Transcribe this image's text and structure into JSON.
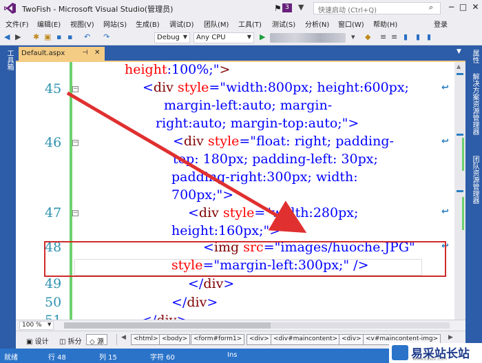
{
  "window": {
    "title": "TwoFish - Microsoft Visual Studio(管理员)",
    "notification_count": "3",
    "quick_launch_placeholder": "快速启动 (Ctrl+Q)",
    "controls": [
      "−",
      "□",
      "✕"
    ]
  },
  "menu": {
    "items": [
      "文件(F)",
      "编辑(E)",
      "视图(V)",
      "网站(S)",
      "生成(B)",
      "调试(D)",
      "团队(M)",
      "工具(T)",
      "测试(S)",
      "分析(N)",
      "窗口(W)",
      "帮助(H)"
    ],
    "login": "登录"
  },
  "toolbar": {
    "configuration": "Debug",
    "platform": "Any CPU"
  },
  "left_strip": {
    "label": "工具箱"
  },
  "right_strip": {
    "labels": [
      "属性",
      "解决方案资源管理器",
      "团队资源管理器"
    ]
  },
  "tabs": {
    "active": {
      "label": "Default.aspx",
      "pin": "⊣",
      "close": "✕"
    }
  },
  "editor": {
    "line_numbers": [
      "45",
      "46",
      "47",
      "48",
      "49",
      "50",
      "51"
    ],
    "code_lines": [
      {
        "parts": [
          [
            "c-attr",
            "height"
          ],
          [
            "c-punct",
            ":"
          ],
          [
            "c-val",
            "100%;\""
          ],
          [
            "c-tag",
            ">"
          ]
        ]
      },
      {
        "parts": [
          [
            "c-punct",
            "<"
          ],
          [
            "c-tag",
            "div"
          ],
          [
            "c-attr",
            " style"
          ],
          [
            "c-punct",
            "=\""
          ],
          [
            "c-val",
            "width:800px; height:600px;"
          ]
        ]
      },
      {
        "parts": [
          [
            "c-val",
            "margin-left:auto; margin-"
          ]
        ]
      },
      {
        "parts": [
          [
            "c-val",
            "right:auto; margin-top:auto;\""
          ],
          [
            "c-punct",
            ">"
          ]
        ]
      },
      {
        "parts": [
          [
            "c-punct",
            "<"
          ],
          [
            "c-tag",
            "div"
          ],
          [
            "c-attr",
            " style"
          ],
          [
            "c-punct",
            "=\""
          ],
          [
            "c-val",
            "float: right; padding-"
          ]
        ]
      },
      {
        "parts": [
          [
            "c-val",
            "top: 180px; padding-left: 30px;"
          ]
        ]
      },
      {
        "parts": [
          [
            "c-val",
            "padding-right:300px; width:"
          ]
        ]
      },
      {
        "parts": [
          [
            "c-val",
            "700px;\""
          ],
          [
            "c-punct",
            ">"
          ]
        ]
      },
      {
        "parts": [
          [
            "c-punct",
            "<"
          ],
          [
            "c-tag",
            "div"
          ],
          [
            "c-attr",
            " style"
          ],
          [
            "c-punct",
            "=\""
          ],
          [
            "c-val",
            "width:280px;"
          ]
        ]
      },
      {
        "parts": [
          [
            "c-val",
            "height:160px;\""
          ],
          [
            "c-punct",
            ">"
          ]
        ]
      },
      {
        "parts": [
          [
            "c-punct",
            "<"
          ],
          [
            "c-tag",
            "img"
          ],
          [
            "c-attr",
            " src"
          ],
          [
            "c-punct",
            "=\""
          ],
          [
            "c-val",
            "images/huoche.JPG\""
          ]
        ]
      },
      {
        "parts": [
          [
            "c-attr",
            "style"
          ],
          [
            "c-punct",
            "=\""
          ],
          [
            "c-val",
            "margin-left:300px;\""
          ],
          [
            "c-punct",
            " />"
          ]
        ]
      },
      {
        "parts": [
          [
            "c-punct",
            "</"
          ],
          [
            "c-tag",
            "div"
          ],
          [
            "c-punct",
            ">"
          ]
        ]
      },
      {
        "parts": [
          [
            "c-punct",
            "</"
          ],
          [
            "c-tag",
            "div"
          ],
          [
            "c-punct",
            ">"
          ]
        ]
      },
      {
        "parts": [
          [
            "c-punct",
            "</"
          ],
          [
            "c-tag",
            "div"
          ],
          [
            "c-punct",
            ">"
          ]
        ]
      }
    ]
  },
  "zoom": {
    "value": "100 %"
  },
  "view_tabs": [
    "设计",
    "拆分",
    "源"
  ],
  "breadcrumbs": [
    "<html>",
    "<body>",
    "<form#form1>",
    "<div>",
    "<div#maincontent>",
    "<div>",
    "<v#maincontent-img>"
  ],
  "status": {
    "ready": "就绪",
    "line": "行 48",
    "col": "列 15",
    "char": "字符 60",
    "mode": "Ins"
  },
  "watermark": {
    "text": "易采站长站",
    "sub": "Www.Easck.Com"
  }
}
